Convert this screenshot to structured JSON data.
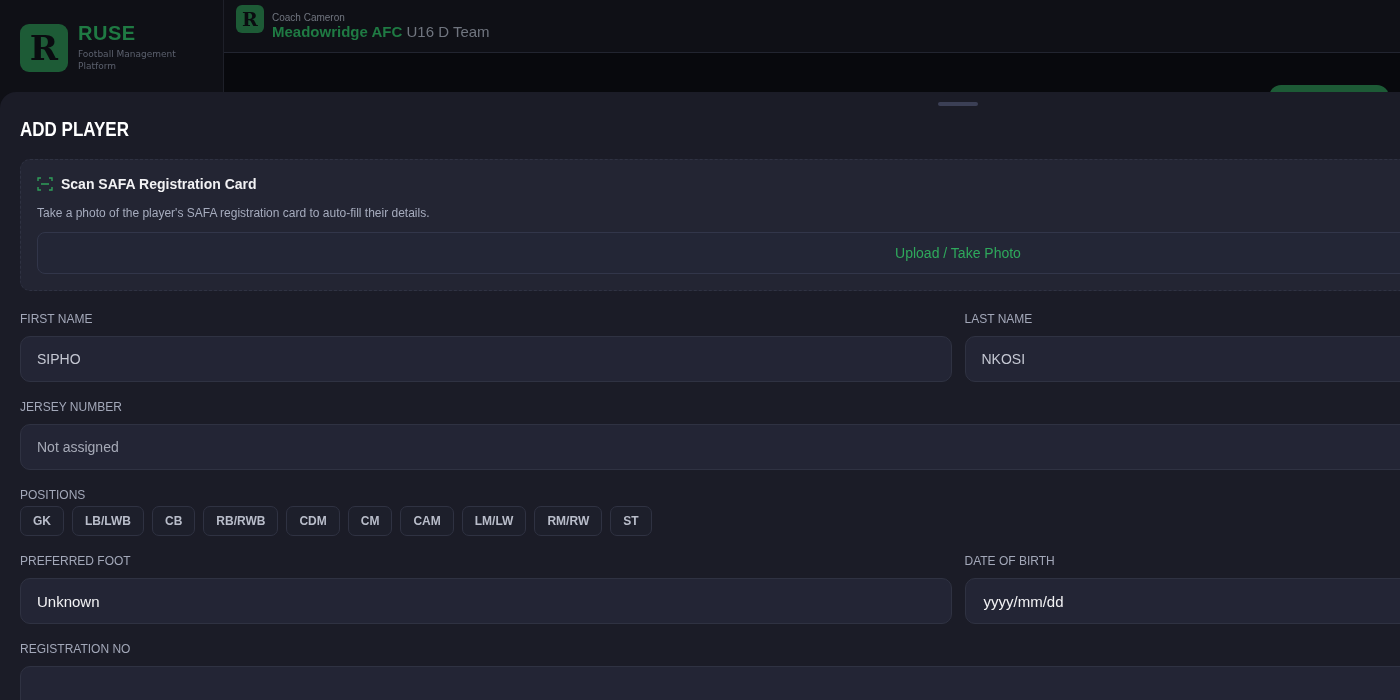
{
  "brand": {
    "logo_letter": "R",
    "name": "RUSE",
    "tagline": "Football Management Platform"
  },
  "header": {
    "logo_letter": "R",
    "coach": "Coach Cameron",
    "club": "Meadowridge AFC",
    "team": "U16 D Team"
  },
  "sheet": {
    "title": "ADD PLAYER",
    "scan": {
      "title": "Scan SAFA Registration Card",
      "description": "Take a photo of the player's SAFA registration card to auto-fill their details.",
      "button": "Upload / Take Photo"
    },
    "rows": [
      [
        {
          "kind": "input",
          "label": "FIRST NAME",
          "value": "SIPHO"
        },
        {
          "kind": "input",
          "label": "LAST NAME",
          "value": "NKOSI"
        }
      ],
      [
        {
          "kind": "input",
          "label": "JERSEY NUMBER",
          "placeholder": "Not assigned"
        }
      ],
      [
        {
          "kind": "chips",
          "label": "POSITIONS",
          "options": [
            {
              "label": "GK",
              "selected": false
            },
            {
              "label": "LB/LWB",
              "selected": false
            },
            {
              "label": "CB",
              "selected": false
            },
            {
              "label": "RB/RWB",
              "selected": false
            },
            {
              "label": "CDM",
              "selected": false
            },
            {
              "label": "CM",
              "selected": false
            },
            {
              "label": "CAM",
              "selected": false
            },
            {
              "label": "LM/LW",
              "selected": false
            },
            {
              "label": "RM/RW",
              "selected": false
            },
            {
              "label": "ST",
              "selected": false
            }
          ]
        }
      ],
      [
        {
          "kind": "select",
          "label": "PREFERRED FOOT",
          "value": "Unknown"
        },
        {
          "kind": "date",
          "label": "DATE OF BIRTH",
          "value": "yyyy/mm/dd"
        }
      ],
      [
        {
          "kind": "input",
          "label": "REGISTRATION NO"
        }
      ]
    ]
  }
}
